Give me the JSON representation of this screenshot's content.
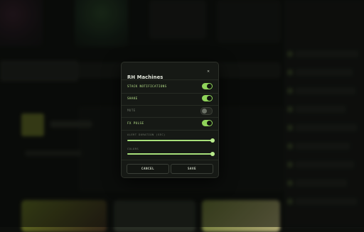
{
  "modal": {
    "title": "RH Machines",
    "close_icon": "close-icon",
    "toggles": [
      {
        "label": "STACK NOTIFICATIONS",
        "on": true
      },
      {
        "label": "SHAKE",
        "on": true
      },
      {
        "label": "MUTE",
        "on": false
      },
      {
        "label": "FX PULSE",
        "on": true
      }
    ],
    "sliders": [
      {
        "label": "ALERT DURATION (SEC)",
        "value": 1.0
      },
      {
        "label": "COLORS",
        "value": 1.0
      }
    ],
    "cancel_label": "CANCEL",
    "save_label": "SAVE"
  },
  "colors": {
    "accent": "#8fd35a",
    "panel": "#161915",
    "background": "#0d0f0c"
  }
}
